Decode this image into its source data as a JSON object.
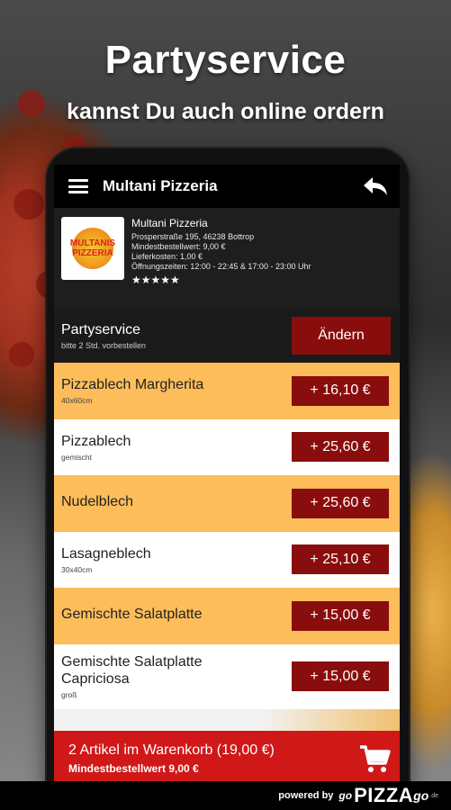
{
  "promo": {
    "headline": "Partyservice",
    "subline": "kannst Du auch online ordern"
  },
  "appbar": {
    "title": "Multani Pizzeria",
    "menu_icon": "hamburger-menu-icon",
    "back_icon": "back-arrow-icon"
  },
  "restaurant": {
    "logo_line1": "MULTANIS",
    "logo_line2": "PIZZERIA",
    "name": "Multani Pizzeria",
    "address": "Prosperstraße 195, 46238 Bottrop",
    "min_order": "Mindestbestellwert: 9,00 €",
    "delivery_cost": "Lieferkosten: 1,00 €",
    "hours": "Öffnungszeiten: 12:00 - 22:45 & 17:00 - 23:00 Uhr",
    "stars": "★★★★★"
  },
  "category": {
    "title": "Partyservice",
    "subtitle": "bitte 2 Std. vorbestellen",
    "change_label": "Ändern"
  },
  "items": [
    {
      "name": "Pizzablech Margherita",
      "desc": "40x60cm",
      "price": "+ 16,10 €"
    },
    {
      "name": "Pizzablech",
      "desc": "gemischt",
      "price": "+ 25,60 €"
    },
    {
      "name": "Nudelblech",
      "desc": "",
      "price": "+ 25,60 €"
    },
    {
      "name": "Lasagneblech",
      "desc": "30x40cm",
      "price": "+ 25,10 €"
    },
    {
      "name": "Gemischte Salatplatte",
      "desc": "",
      "price": "+ 15,00 €"
    },
    {
      "name": "Gemischte Salatplatte Capriciosa",
      "desc": "groß",
      "price": "+ 15,00 €"
    }
  ],
  "cart": {
    "summary": "2 Artikel im Warenkorb (19,00 €)",
    "min_order": "Mindestbestellwert 9,00 €",
    "icon": "shopping-cart-icon"
  },
  "footer": {
    "powered": "powered by",
    "go": "go",
    "pizza": "PIZZA",
    "go2": "go",
    "de": ".de"
  },
  "colors": {
    "accent_red": "#8a0d0d",
    "cart_red": "#d01818",
    "item_orange": "#fdbd5a"
  }
}
